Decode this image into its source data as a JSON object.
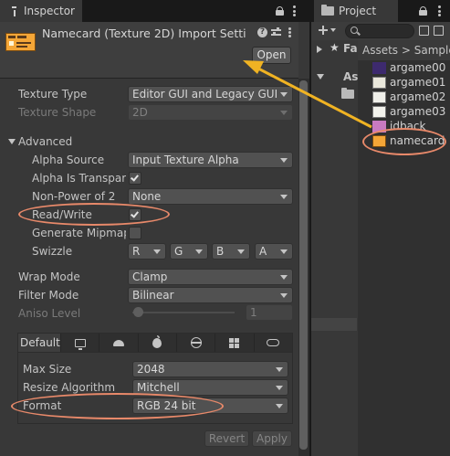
{
  "inspector": {
    "tab_label": "Inspector",
    "title": "Namecard (Texture 2D) Import Setti",
    "open_button": "Open",
    "texture_type": {
      "label": "Texture Type",
      "value": "Editor GUI and Legacy GUI"
    },
    "texture_shape": {
      "label": "Texture Shape",
      "value": "2D"
    },
    "advanced": {
      "label": "Advanced",
      "alpha_source": {
        "label": "Alpha Source",
        "value": "Input Texture Alpha"
      },
      "alpha_is_transparency": {
        "label": "Alpha Is Transpare",
        "checked": true
      },
      "non_power_of_2": {
        "label": "Non-Power of 2",
        "value": "None"
      },
      "read_write": {
        "label": "Read/Write",
        "checked": true
      },
      "generate_mipmap": {
        "label": "Generate Mipmap",
        "checked": false
      },
      "swizzle": {
        "label": "Swizzle",
        "values": [
          "R",
          "G",
          "B",
          "A"
        ]
      }
    },
    "wrap_mode": {
      "label": "Wrap Mode",
      "value": "Clamp"
    },
    "filter_mode": {
      "label": "Filter Mode",
      "value": "Bilinear"
    },
    "aniso_level": {
      "label": "Aniso Level",
      "value": "1"
    },
    "platform": {
      "default_tab": "Default",
      "platform_icons": [
        "monitor-icon",
        "android-icon",
        "apple-icon",
        "webgl-icon",
        "windows-icon",
        "gamepad-icon"
      ],
      "max_size": {
        "label": "Max Size",
        "value": "2048"
      },
      "resize_algorithm": {
        "label": "Resize Algorithm",
        "value": "Mitchell"
      },
      "format": {
        "label": "Format",
        "value": "RGB 24 bit"
      }
    },
    "revert_button": "Revert",
    "apply_button": "Apply"
  },
  "project": {
    "tab_label": "Project",
    "breadcrumb": "Assets > Sample",
    "tree": [
      "Fa",
      "As"
    ],
    "assets": [
      "argame00",
      "argame01",
      "argame02",
      "argame03",
      "idback",
      "namecard"
    ]
  },
  "annotation_color": "#e8896a",
  "arrow_color": "#f0b323"
}
